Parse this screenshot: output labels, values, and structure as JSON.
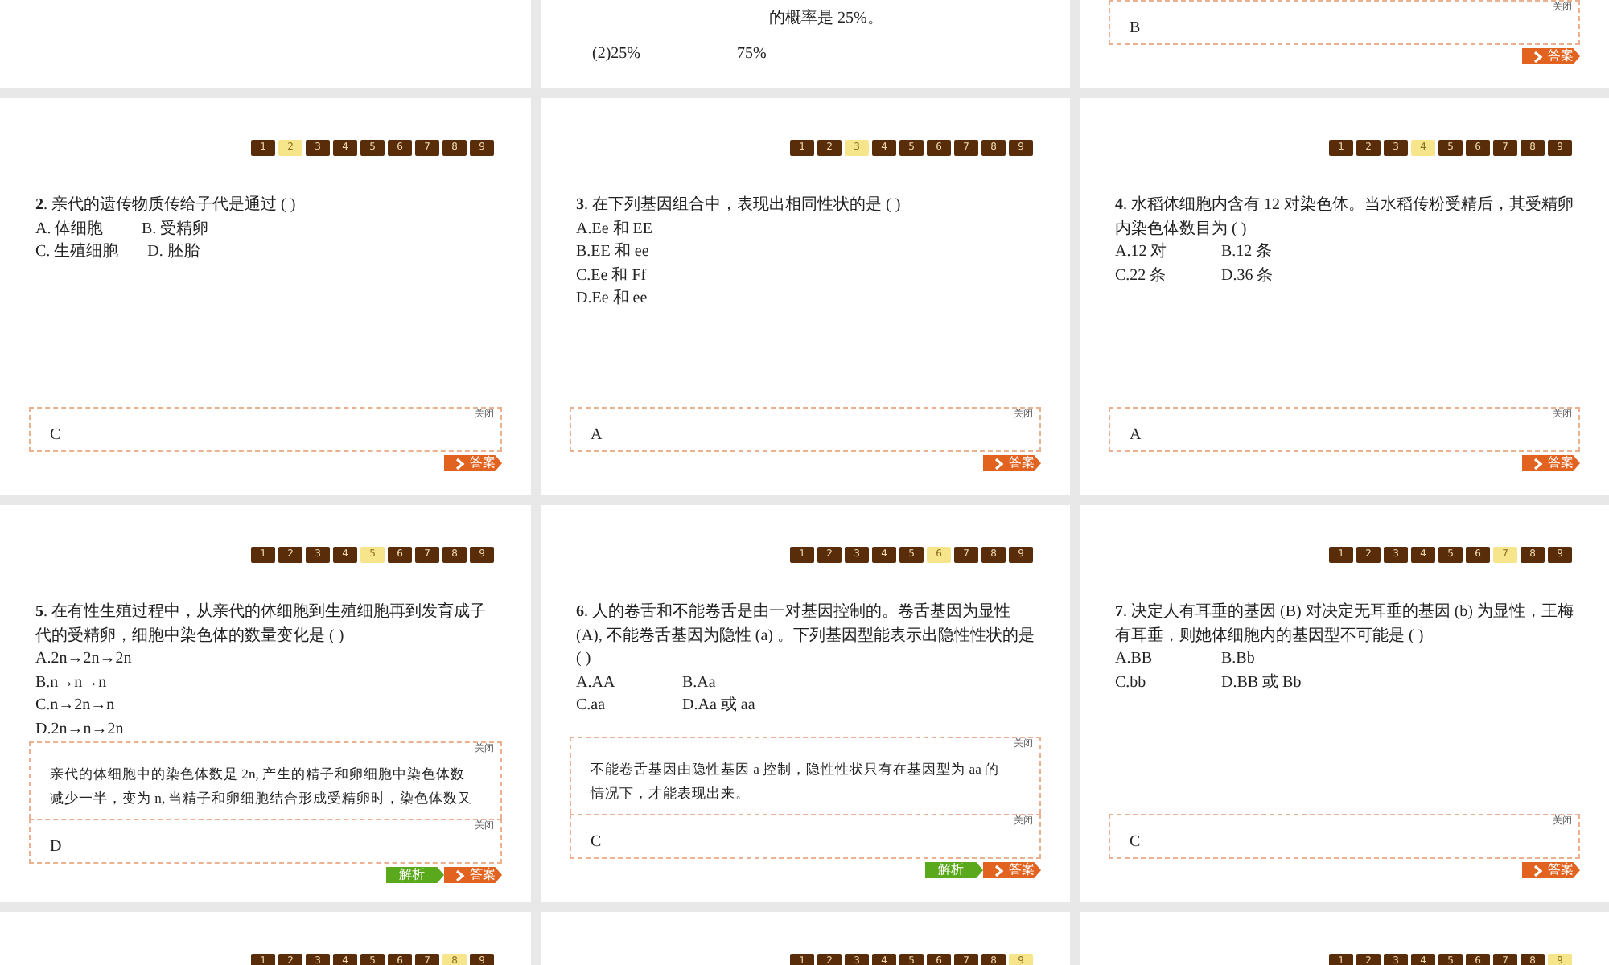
{
  "slides": [
    {
      "kind": "blank"
    },
    {
      "kind": "fragment",
      "fragment_lines": [
        [
          "的概率是 25%。"
        ],
        [
          "(2)25%",
          "75%"
        ]
      ]
    },
    {
      "kind": "question",
      "answer_box": {
        "close_label": "关闭",
        "answer": "B"
      },
      "buttons": [
        {
          "kind": "answer",
          "label": "答案"
        }
      ]
    },
    {
      "kind": "question",
      "nav": [
        {
          "label": "1",
          "selected": false
        },
        {
          "label": "2",
          "selected": true
        },
        {
          "label": "3",
          "selected": false
        },
        {
          "label": "4",
          "selected": false
        },
        {
          "label": "5",
          "selected": false
        },
        {
          "label": "6",
          "selected": false
        },
        {
          "label": "7",
          "selected": false
        },
        {
          "label": "8",
          "selected": false
        },
        {
          "label": "9",
          "selected": false
        }
      ],
      "question": "**2**. 亲代的遗传物质传给子代是通过 ( )",
      "options": [
        [
          "A. 体细胞",
          "B. 受精卵"
        ],
        [
          "C. 生殖细胞",
          "D. 胚胎"
        ]
      ],
      "answer_box": {
        "close_label": "关闭",
        "answer": "C"
      },
      "buttons": [
        {
          "kind": "answer",
          "label": "答案"
        }
      ]
    },
    {
      "kind": "question",
      "nav": [
        {
          "label": "1",
          "selected": false
        },
        {
          "label": "2",
          "selected": false
        },
        {
          "label": "3",
          "selected": true
        },
        {
          "label": "4",
          "selected": false
        },
        {
          "label": "5",
          "selected": false
        },
        {
          "label": "6",
          "selected": false
        },
        {
          "label": "7",
          "selected": false
        },
        {
          "label": "8",
          "selected": false
        },
        {
          "label": "9",
          "selected": false
        }
      ],
      "question": "**3**. 在下列基因组合中，表现出相同性状的是 (   )",
      "options": [
        [
          "A.Ee 和 EE"
        ],
        [
          "B.EE 和 ee"
        ],
        [
          "C.Ee 和 Ff"
        ],
        [
          "D.Ee 和 ee"
        ]
      ],
      "answer_box": {
        "close_label": "关闭",
        "answer": "A"
      },
      "buttons": [
        {
          "kind": "answer",
          "label": "答案"
        }
      ]
    },
    {
      "kind": "question",
      "nav": [
        {
          "label": "1",
          "selected": false
        },
        {
          "label": "2",
          "selected": false
        },
        {
          "label": "3",
          "selected": false
        },
        {
          "label": "4",
          "selected": true
        },
        {
          "label": "5",
          "selected": false
        },
        {
          "label": "6",
          "selected": false
        },
        {
          "label": "7",
          "selected": false
        },
        {
          "label": "8",
          "selected": false
        },
        {
          "label": "9",
          "selected": false
        }
      ],
      "question": "**4**. 水稻体细胞内含有 12 对染色体。当水稻传粉受精后，其受精卵内染色体数目为 (   )",
      "options": [
        [
          "A.12 对",
          "B.12 条"
        ],
        [
          "C.22 条",
          "D.36 条"
        ]
      ],
      "answer_box": {
        "close_label": "关闭",
        "answer": "A"
      },
      "buttons": [
        {
          "kind": "answer",
          "label": "答案"
        }
      ]
    },
    {
      "kind": "question",
      "nav": [
        {
          "label": "1",
          "selected": false
        },
        {
          "label": "2",
          "selected": false
        },
        {
          "label": "3",
          "selected": false
        },
        {
          "label": "4",
          "selected": false
        },
        {
          "label": "5",
          "selected": true
        },
        {
          "label": "6",
          "selected": false
        },
        {
          "label": "7",
          "selected": false
        },
        {
          "label": "8",
          "selected": false
        },
        {
          "label": "9",
          "selected": false
        }
      ],
      "question": "**5**. 在有性生殖过程中，从亲代的体细胞到生殖细胞再到发育成子代的受精卵，细胞中染色体的数量变化是 (   )",
      "options": [
        [
          "A.2n→2n→2n"
        ],
        [
          "B.n→n→n"
        ],
        [
          "C.n→2n→n"
        ],
        [
          "D.2n→n→2n"
        ]
      ],
      "explanation": {
        "close_label": "关闭",
        "lines": [
          "亲代的体细胞中的染色体数是 2n, 产生的精子和卵细胞中染色体数",
          "减少一半，变为 n, 当精子和卵细胞结合形成受精卵时，染色体数又"
        ]
      },
      "answer_box": {
        "close_label": "关闭",
        "answer": "D"
      },
      "buttons": [
        {
          "kind": "explanation",
          "label": "解析"
        },
        {
          "kind": "answer",
          "label": "答案"
        }
      ]
    },
    {
      "kind": "question",
      "nav": [
        {
          "label": "1",
          "selected": false
        },
        {
          "label": "2",
          "selected": false
        },
        {
          "label": "3",
          "selected": false
        },
        {
          "label": "4",
          "selected": false
        },
        {
          "label": "5",
          "selected": false
        },
        {
          "label": "6",
          "selected": true
        },
        {
          "label": "7",
          "selected": false
        },
        {
          "label": "8",
          "selected": false
        },
        {
          "label": "9",
          "selected": false
        }
      ],
      "question": "**6**. 人的卷舌和不能卷舌是由一对基因控制的。卷舌基因为显性 (A), 不能卷舌基因为隐性 (a) 。下列基因型能表示出隐性性状的是 (   )",
      "options": [
        [
          "A.AA",
          "B.Aa"
        ],
        [
          "C.aa",
          "D.Aa 或 aa"
        ]
      ],
      "explanation": {
        "close_label": "关闭",
        "lines": [
          "不能卷舌基因由隐性基因 a 控制，隐性性状只有在基因型为 aa 的",
          "情况下，才能表现出来。"
        ]
      },
      "answer_box": {
        "close_label": "关闭",
        "answer": "C"
      },
      "buttons": [
        {
          "kind": "explanation",
          "label": "解析"
        },
        {
          "kind": "answer",
          "label": "答案"
        }
      ]
    },
    {
      "kind": "question",
      "nav": [
        {
          "label": "1",
          "selected": false
        },
        {
          "label": "2",
          "selected": false
        },
        {
          "label": "3",
          "selected": false
        },
        {
          "label": "4",
          "selected": false
        },
        {
          "label": "5",
          "selected": false
        },
        {
          "label": "6",
          "selected": false
        },
        {
          "label": "7",
          "selected": true
        },
        {
          "label": "8",
          "selected": false
        },
        {
          "label": "9",
          "selected": false
        }
      ],
      "question": "**7**. 决定人有耳垂的基因 (B) 对决定无耳垂的基因 (b) 为显性，王梅有耳垂，则她体细胞内的基因型不可能是 (   )",
      "options": [
        [
          "A.BB",
          "B.Bb"
        ],
        [
          "C.bb",
          "D.BB 或 Bb"
        ]
      ],
      "answer_box": {
        "close_label": "关闭",
        "answer": "C"
      },
      "buttons": [
        {
          "kind": "answer",
          "label": "答案"
        }
      ]
    },
    {
      "kind": "question",
      "nav": [
        {
          "label": "1",
          "selected": false
        },
        {
          "label": "2",
          "selected": false
        },
        {
          "label": "3",
          "selected": false
        },
        {
          "label": "4",
          "selected": false
        },
        {
          "label": "5",
          "selected": false
        },
        {
          "label": "6",
          "selected": false
        },
        {
          "label": "7",
          "selected": false
        },
        {
          "label": "8",
          "selected": true
        },
        {
          "label": "9",
          "selected": false
        }
      ]
    },
    {
      "kind": "question",
      "nav": [
        {
          "label": "1",
          "selected": false
        },
        {
          "label": "2",
          "selected": false
        },
        {
          "label": "3",
          "selected": false
        },
        {
          "label": "4",
          "selected": false
        },
        {
          "label": "5",
          "selected": false
        },
        {
          "label": "6",
          "selected": false
        },
        {
          "label": "7",
          "selected": false
        },
        {
          "label": "8",
          "selected": false
        },
        {
          "label": "9",
          "selected": true
        }
      ]
    },
    {
      "kind": "question",
      "nav": [
        {
          "label": "1",
          "selected": false
        },
        {
          "label": "2",
          "selected": false
        },
        {
          "label": "3",
          "selected": false
        },
        {
          "label": "4",
          "selected": false
        },
        {
          "label": "5",
          "selected": false
        },
        {
          "label": "6",
          "selected": false
        },
        {
          "label": "7",
          "selected": false
        },
        {
          "label": "8",
          "selected": false
        },
        {
          "label": "9",
          "selected": true
        }
      ]
    }
  ]
}
